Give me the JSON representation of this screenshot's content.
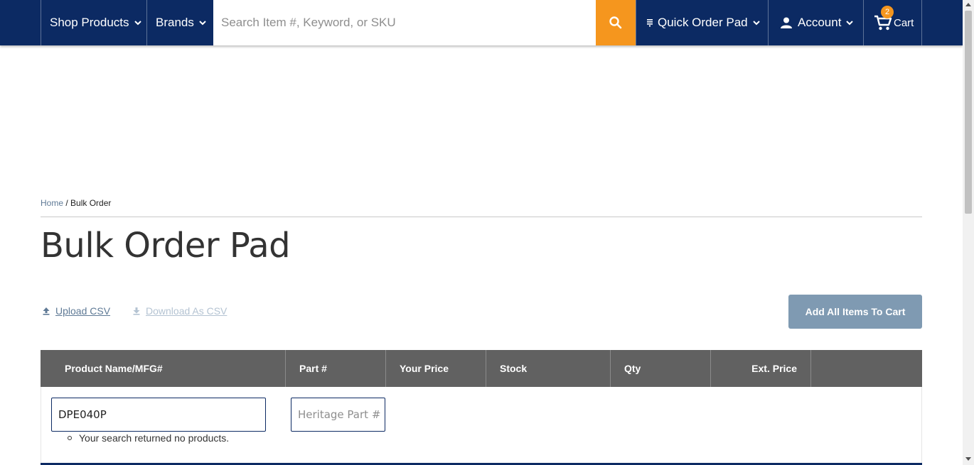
{
  "nav": {
    "shop_label": "Shop Products",
    "brands_label": "Brands",
    "search_placeholder": "Search Item #, Keyword, or SKU",
    "quick_order_label": "Quick Order Pad",
    "account_label": "Account",
    "cart_label": "Cart",
    "cart_count": "2"
  },
  "breadcrumb": {
    "home": "Home",
    "separator": "/",
    "current": "Bulk Order"
  },
  "page_title": "Bulk Order Pad",
  "actions": {
    "upload_csv": "Upload CSV",
    "download_csv": "Download As CSV",
    "add_all": "Add All Items To Cart"
  },
  "table": {
    "columns": [
      "Product Name/MFG#",
      "Part #",
      "Your Price",
      "Stock",
      "Qty",
      "Ext. Price"
    ],
    "row": {
      "mfg_value": "DPE040P",
      "part_placeholder": "Heritage Part #",
      "message": "Your search returned no products."
    }
  },
  "colors": {
    "nav_bg": "#0c2a63",
    "accent_orange": "#f5961e",
    "button_disabled": "#7f9ab2",
    "table_header": "#616161"
  }
}
